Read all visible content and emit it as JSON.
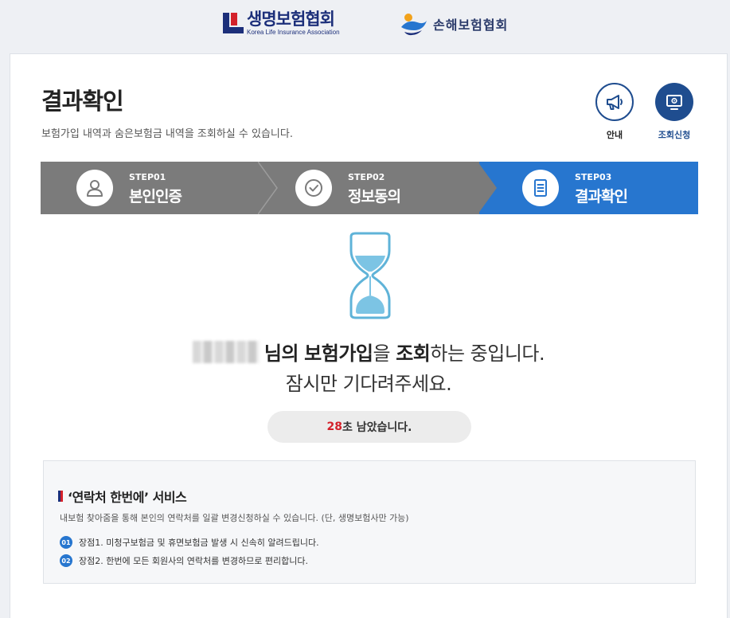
{
  "header": {
    "life_logo_ko": "생명보험협회",
    "life_logo_en": "Korea Life Insurance Association",
    "nonlife_logo_ko": "손해보험협회"
  },
  "page": {
    "title": "결과확인",
    "subtitle": "보험가입 내역과 숨은보험금 내역을 조회하실 수 있습니다."
  },
  "actions": {
    "guide_label": "안내",
    "apply_label": "조회신청"
  },
  "steps": [
    {
      "no": "STEP01",
      "name": "본인인증",
      "icon": "person-icon",
      "active": false
    },
    {
      "no": "STEP02",
      "name": "정보동의",
      "icon": "check-circle-icon",
      "active": false
    },
    {
      "no": "STEP03",
      "name": "결과확인",
      "icon": "document-icon",
      "active": true
    }
  ],
  "status": {
    "msg_name_suffix": "님의",
    "msg_bold1": "보험가입",
    "msg_part2": "을",
    "msg_bold2": "조회",
    "msg_part3": "하는 중입니다.",
    "msg_line2": "잠시만 기다려주세요.",
    "timer_seconds": "28",
    "timer_suffix": "초 남았습니다."
  },
  "info": {
    "title": "‘연락처 한번에’ 서비스",
    "desc": "내보험 찾아줌을 통해 본인의 연락처를 일괄 변경신청하실 수 있습니다. (단, 생명보험사만 가능)",
    "points": [
      {
        "num": "01",
        "text": "장점1. 미청구보험금 및 휴면보험금 발생 시 신속히 알려드립니다."
      },
      {
        "num": "02",
        "text": "장점2. 한번에 모든 회원사의 연락처를 변경하므로 편리합니다."
      }
    ]
  },
  "colors": {
    "active_step": "#2776cf",
    "inactive_step": "#7b7b7b",
    "brand_navy": "#1f4d8f",
    "timer_accent": "#d4212a"
  }
}
